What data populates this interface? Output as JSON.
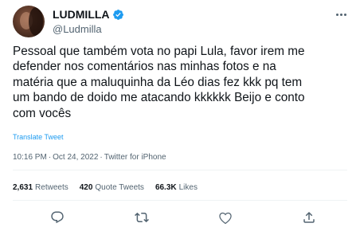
{
  "author": {
    "display_name": "LUDMILLA",
    "handle": "@Ludmilla",
    "verified": true
  },
  "tweet": {
    "text": "Pessoal que também vota no papi Lula, favor irem me\ndefender nos comentários nas minhas fotos e na\nmatéria que a maluquinha da Léo dias fez kkk pq tem\num bando de doido me atacando kkkkkk Beijo e conto\ncom vocês",
    "translate_label": "Translate Tweet",
    "time": "10:16 PM",
    "date": "Oct 24, 2022",
    "separator": "·",
    "source": "Twitter for iPhone"
  },
  "stats": {
    "retweets_count": "2,631",
    "retweets_label": "Retweets",
    "quotes_count": "420",
    "quotes_label": "Quote Tweets",
    "likes_count": "66.3K",
    "likes_label": "Likes"
  },
  "actions": [
    "reply-icon",
    "retweet-icon",
    "like-icon",
    "share-icon"
  ],
  "colors": {
    "text": "#0f1419",
    "secondary": "#536471",
    "accent": "#1d9bf0",
    "divider": "#eff3f4"
  }
}
